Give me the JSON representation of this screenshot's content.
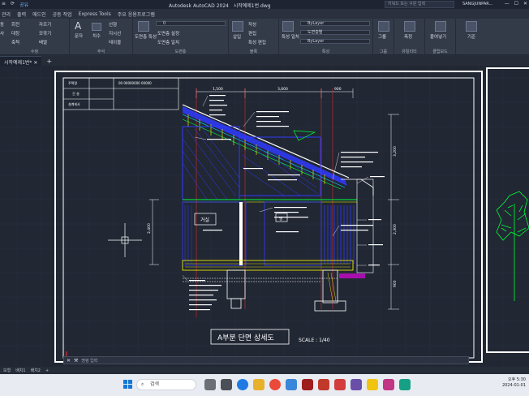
{
  "titlebar": {
    "quick_access": [
      "≡",
      "⟳"
    ],
    "share_label": "공유",
    "app_title": "Autodesk AutoCAD 2024",
    "file_name": "시작예제1번.dwg",
    "search_placeholder": "키워드 또는 구문 입력",
    "user": "SANGJUNPAR..."
  },
  "menu_tabs": [
    "관리",
    "출력",
    "애드인",
    "공동 작업",
    "Express Tools",
    "주요 응용프로그램"
  ],
  "ribbon": {
    "draw": {
      "items": [
        "동",
        "회전",
        "자르기",
        "사",
        "대칭",
        "모깎기",
        "축척",
        "배열"
      ],
      "title": "수정"
    },
    "annotation": {
      "text_label": "문자",
      "dim_label": "치수",
      "items": [
        "선형",
        "지시선",
        "테이블"
      ],
      "title": "주석"
    },
    "layers": {
      "layer_label": "도면층 특성",
      "layer_value": "0",
      "items": [
        "도면층 설정",
        "도면층 일치",
        "도면층"
      ],
      "title": "도면층"
    },
    "block": {
      "insert_label": "삽입",
      "items": [
        "작성",
        "편집",
        "특성 편집"
      ],
      "title": "블록"
    },
    "properties": {
      "match_label": "특성 일치",
      "color": "ByLayer",
      "linetype": "도면층별",
      "lineweight": "ByLayer",
      "title": "특성"
    },
    "groups": {
      "label": "그룹",
      "title": "그룹"
    },
    "utilities": {
      "label": "측정",
      "title": "유틸리티"
    },
    "clipboard": {
      "label": "붙여넣기",
      "title": "클립보드"
    },
    "view": {
      "label": "기준",
      "title": ""
    }
  },
  "file_tab": "시작예제1번*",
  "drawing": {
    "titleblock": [
      "주택명",
      "건 설",
      "설계회사"
    ],
    "titleblock_value": "00 00000000 00000",
    "dim_top": [
      "1,500",
      "3,600",
      "900"
    ],
    "dim_left": "2,400",
    "dim_right": [
      "3,200",
      "2,300",
      "900"
    ],
    "room_living": "거실",
    "room_small": "방",
    "caption": "A부분 단면 상세도",
    "scale": "SCALE : 1/40",
    "colors": {
      "yellow": "#ffff00",
      "blue": "#2f3bff",
      "cyan": "#00e5ff",
      "green": "#00ff3b",
      "white": "#ffffff",
      "red": "#ff2b2b",
      "magenta": "#ff00ff"
    }
  },
  "command_placeholder": "명령 입력",
  "statusbar": [
    "모형",
    "배치1",
    "배치2",
    "+"
  ],
  "taskbar": {
    "search": "검색",
    "time": "오후 5:30",
    "date": "2024-01-01"
  }
}
